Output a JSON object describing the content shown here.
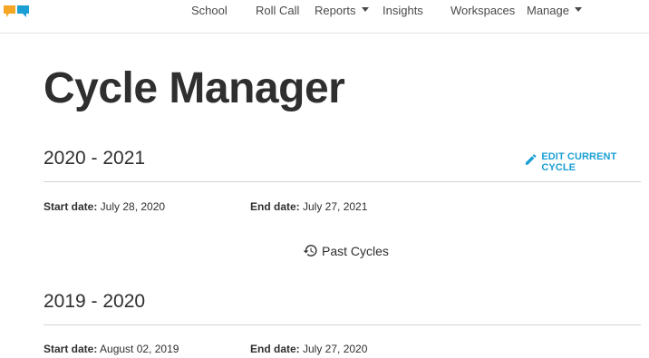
{
  "nav": {
    "items": [
      {
        "label": "School",
        "dropdown": false
      },
      {
        "label": "Roll Call",
        "dropdown": false
      },
      {
        "label": "Reports",
        "dropdown": true
      },
      {
        "label": "Insights",
        "dropdown": false
      },
      {
        "label": "Workspaces",
        "dropdown": false
      },
      {
        "label": "Manage",
        "dropdown": true
      }
    ]
  },
  "colors": {
    "accent": "#1a9fd4",
    "logo_orange": "#f5a623",
    "logo_blue": "#1a9fd4"
  },
  "page": {
    "title": "Cycle Manager"
  },
  "current_cycle": {
    "heading": "2020 - 2021",
    "edit_label": "EDIT CURRENT CYCLE",
    "edit_icon": "pencil-icon",
    "start_label": "Start date:",
    "start_value": " July 28, 2020",
    "end_label": "End date:",
    "end_value": " July 27, 2021"
  },
  "past_cycles": {
    "label": "Past Cycles",
    "icon": "history-icon",
    "cycles": [
      {
        "heading": "2019 - 2020",
        "start_label": "Start date:",
        "start_value": " August 02, 2019",
        "end_label": "End date:",
        "end_value": " July 27, 2020"
      }
    ]
  }
}
